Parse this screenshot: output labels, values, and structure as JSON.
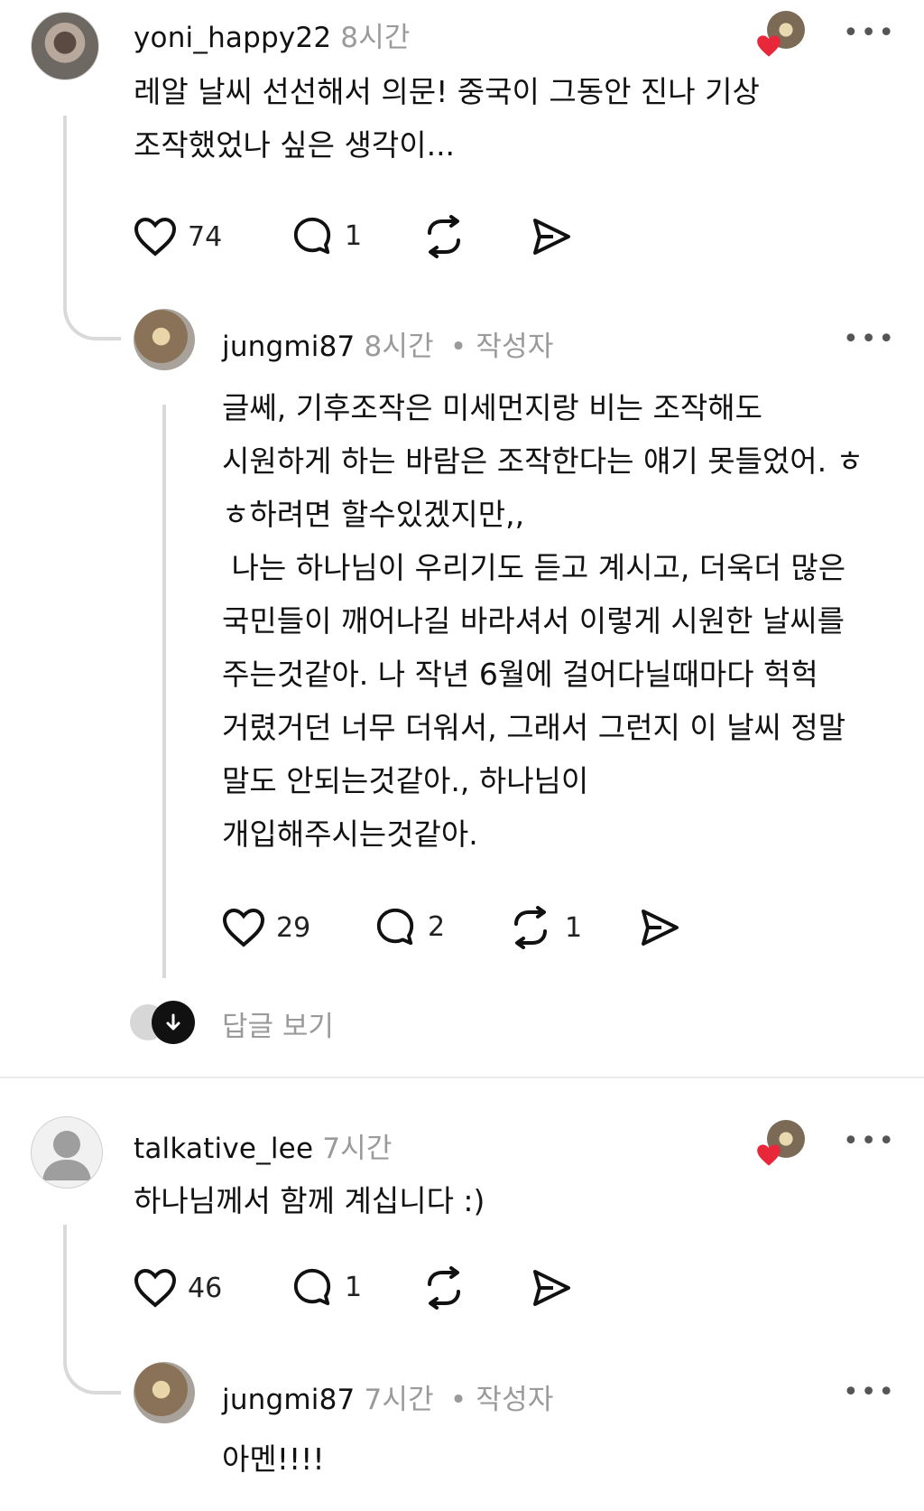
{
  "comments": [
    {
      "username": "yoni_happy22",
      "time": "8시간",
      "text": "레알 날씨 선선해서 의문! 중국이 그동안 진나 기상\n조작했었나 싶은 생각이...",
      "likes": "74",
      "replies": "1",
      "reposts": "",
      "reply": {
        "username": "jungmi87",
        "time": "8시간",
        "author_tag": "• 작성자",
        "text": "글쎄, 기후조작은 미세먼지랑 비는 조작해도\n시원하게 하는 바람은 조작한다는 얘기 못들었어. ㅎ\nㅎ하려면 할수있겠지만,,\n 나는 하나님이 우리기도 듣고 계시고, 더욱더 많은\n국민들이 깨어나길 바라셔서 이렇게 시원한 날씨를\n주는것같아. 나 작년 6월에 걸어다닐때마다 헉헉\n거렸거던 너무 더워서, 그래서 그런지 이 날씨 정말\n말도 안되는것같아., 하나님이\n개입해주시는것같아.",
        "likes": "29",
        "replies": "2",
        "reposts": "1"
      },
      "view_replies_label": "답글 보기"
    },
    {
      "username": "talkative_lee",
      "time": "7시간",
      "text": "하나님께서 함께 계십니다 :)",
      "likes": "46",
      "replies": "1",
      "reposts": "",
      "reply": {
        "username": "jungmi87",
        "time": "7시간",
        "author_tag": "• 작성자",
        "text": "아멘!!!!"
      }
    }
  ],
  "more_label": "•••",
  "colors": {
    "heart_badge": "#e8283a",
    "thread_line": "#d9d9d9",
    "muted": "#9a9a9a"
  },
  "icons": [
    "heart-icon",
    "comment-icon",
    "repost-icon",
    "send-icon",
    "more-icon",
    "arrow-down-icon",
    "default-avatar-icon"
  ]
}
